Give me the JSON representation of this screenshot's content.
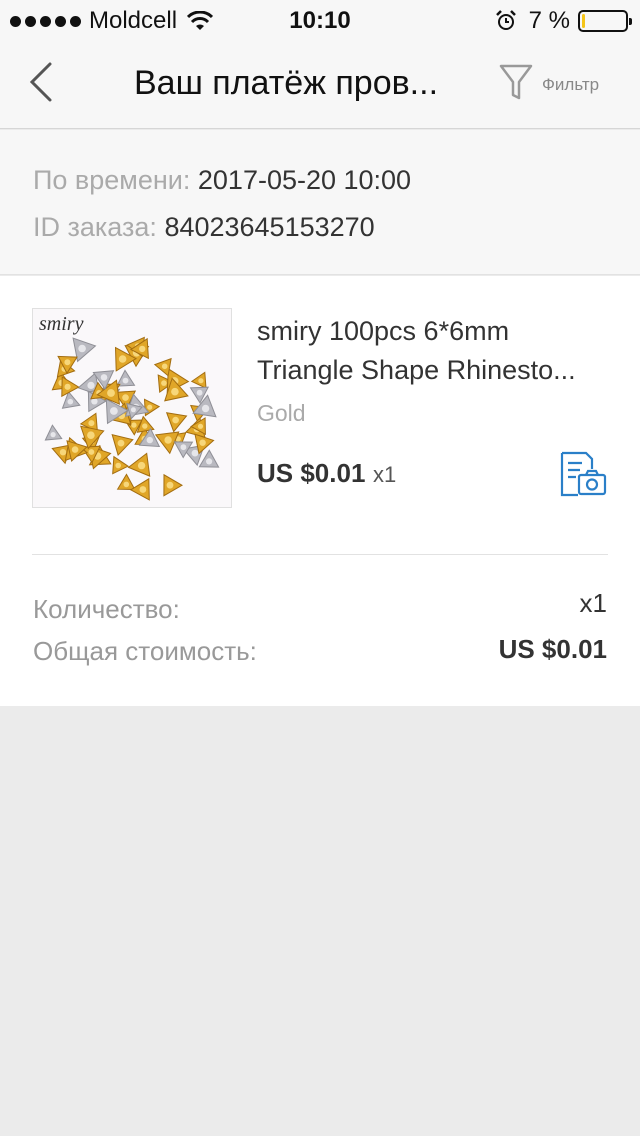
{
  "status_bar": {
    "carrier": "Moldcell",
    "time": "10:10",
    "battery_percent": "7 %",
    "battery_level": 0.07
  },
  "nav": {
    "title": "Ваш платёж пров...",
    "filter_label": "Фильтр"
  },
  "order_info": {
    "time_label": "По времени:",
    "time_value": "2017-05-20 10:00",
    "id_label": "ID заказа:",
    "id_value": "84023645153270"
  },
  "product": {
    "image_brand": "smiry",
    "title_line1": "smiry 100pcs 6*6mm",
    "title_line2": "Triangle Shape Rhinesto...",
    "variant": "Gold",
    "price": "US $0.01",
    "qty": "x1"
  },
  "summary": {
    "quantity_label": "Количество:",
    "quantity_value": "x1",
    "total_label": "Общая стоимость:",
    "total_value": "US $0.01"
  },
  "colors": {
    "accent_blue": "#2a7fc8",
    "gem_gold": "#e0a628"
  }
}
